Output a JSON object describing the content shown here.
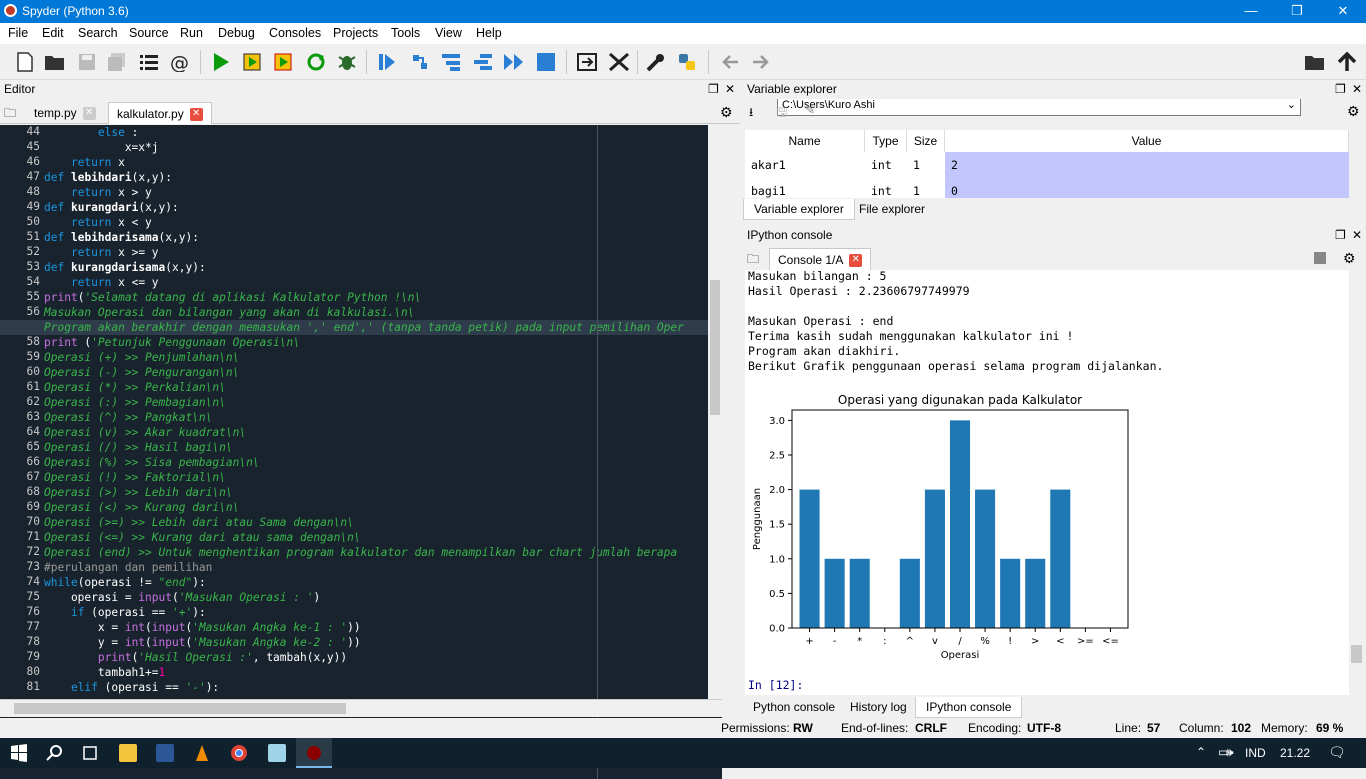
{
  "window": {
    "title": "Spyder (Python 3.6)",
    "minimize": "—",
    "restore": "❐",
    "close": "✕"
  },
  "menu": [
    "File",
    "Edit",
    "Search",
    "Source",
    "Run",
    "Debug",
    "Consoles",
    "Projects",
    "Tools",
    "View",
    "Help"
  ],
  "toolbar": {
    "path": "C:\\Users\\Kuro Ashi",
    "icons": [
      "new-file-icon",
      "open-folder-icon",
      "save-icon",
      "save-all-icon",
      "outline-icon",
      "at-icon",
      "run-icon",
      "run-cell-icon",
      "run-cell-advance-icon",
      "rerun-icon",
      "run-selection-icon",
      "debug-icon",
      "step-icon",
      "step-into-icon",
      "step-return-icon",
      "continue-icon",
      "stop-icon",
      "maximize-pane-icon",
      "fullscreen-icon",
      "preferences-icon",
      "python-path-icon",
      "back-icon",
      "forward-icon",
      "browse-icon",
      "parent-dir-icon"
    ]
  },
  "editor": {
    "pane_title": "Editor",
    "tabs": [
      {
        "label": "temp.py",
        "active": false
      },
      {
        "label": "kalkulator.py",
        "active": true
      }
    ],
    "lines": [
      {
        "n": "44",
        "segs": [
          [
            "        ",
            ""
          ],
          [
            "else",
            ""
          ],
          [
            " :",
            ""
          ]
        ],
        "kwfirst": true
      },
      {
        "n": "45",
        "segs": [
          [
            "            x=x*j",
            ""
          ]
        ]
      },
      {
        "n": "46",
        "segs": [
          [
            "    ",
            ""
          ],
          [
            "return",
            "kw"
          ],
          [
            " x",
            ""
          ]
        ]
      },
      {
        "n": "47",
        "segs": [
          [
            "def",
            "kw"
          ],
          [
            " ",
            ""
          ],
          [
            "lebihdari",
            "fn"
          ],
          [
            "(x,y):",
            ""
          ]
        ]
      },
      {
        "n": "48",
        "segs": [
          [
            "    ",
            ""
          ],
          [
            "return",
            "kw"
          ],
          [
            " x > y",
            ""
          ]
        ]
      },
      {
        "n": "49",
        "segs": [
          [
            "def",
            "kw"
          ],
          [
            " ",
            ""
          ],
          [
            "kurangdari",
            "fn"
          ],
          [
            "(x,y):",
            ""
          ]
        ]
      },
      {
        "n": "50",
        "segs": [
          [
            "    ",
            ""
          ],
          [
            "return",
            "kw"
          ],
          [
            " x < y",
            ""
          ]
        ]
      },
      {
        "n": "51",
        "segs": [
          [
            "def",
            "kw"
          ],
          [
            " ",
            ""
          ],
          [
            "lebihdarisama",
            "fn"
          ],
          [
            "(x,y):",
            ""
          ]
        ]
      },
      {
        "n": "52",
        "segs": [
          [
            "    ",
            ""
          ],
          [
            "return",
            "kw"
          ],
          [
            " x >= y",
            ""
          ]
        ]
      },
      {
        "n": "53",
        "segs": [
          [
            "def",
            "kw"
          ],
          [
            " ",
            ""
          ],
          [
            "kurangdarisama",
            "fn"
          ],
          [
            "(x,y):",
            ""
          ]
        ]
      },
      {
        "n": "54",
        "segs": [
          [
            "    ",
            ""
          ],
          [
            "return",
            "kw"
          ],
          [
            " x <= y",
            ""
          ]
        ]
      },
      {
        "n": "55",
        "segs": [
          [
            "print",
            "bi"
          ],
          [
            "(",
            ""
          ],
          [
            "'Selamat datang di aplikasi Kalkulator Python !\\n\\",
            "st"
          ]
        ]
      },
      {
        "n": "56",
        "segs": [
          [
            "Masukan Operasi dan bilangan yang akan di kalkulasi.\\n\\",
            "st"
          ]
        ]
      },
      {
        "n": "57",
        "segs": [
          [
            "Program akan berakhir dengan memasukan ',' end',' (tanpa tanda petik) pada input pemilihan Oper",
            "st"
          ]
        ],
        "current": true
      },
      {
        "n": "58",
        "segs": [
          [
            "print",
            "bi"
          ],
          [
            " (",
            ""
          ],
          [
            "'Petunjuk Penggunaan Operasi\\n\\",
            "st"
          ]
        ]
      },
      {
        "n": "59",
        "segs": [
          [
            "Operasi (+) >> Penjumlahan\\n\\",
            "st"
          ]
        ]
      },
      {
        "n": "60",
        "segs": [
          [
            "Operasi (-) >> Pengurangan\\n\\",
            "st"
          ]
        ]
      },
      {
        "n": "61",
        "segs": [
          [
            "Operasi (*) >> Perkalian\\n\\",
            "st"
          ]
        ]
      },
      {
        "n": "62",
        "segs": [
          [
            "Operasi (:) >> Pembagian\\n\\",
            "st"
          ]
        ]
      },
      {
        "n": "63",
        "segs": [
          [
            "Operasi (^) >> Pangkat\\n\\",
            "st"
          ]
        ]
      },
      {
        "n": "64",
        "segs": [
          [
            "Operasi (v) >> Akar kuadrat\\n\\",
            "st"
          ]
        ]
      },
      {
        "n": "65",
        "segs": [
          [
            "Operasi (/) >> Hasil bagi\\n\\",
            "st"
          ]
        ]
      },
      {
        "n": "66",
        "segs": [
          [
            "Operasi (%) >> Sisa pembagian\\n\\",
            "st"
          ]
        ]
      },
      {
        "n": "67",
        "segs": [
          [
            "Operasi (!) >> Faktorial\\n\\",
            "st"
          ]
        ]
      },
      {
        "n": "68",
        "segs": [
          [
            "Operasi (>) >> Lebih dari\\n\\",
            "st"
          ]
        ]
      },
      {
        "n": "69",
        "segs": [
          [
            "Operasi (<) >> Kurang dari\\n\\",
            "st"
          ]
        ]
      },
      {
        "n": "70",
        "segs": [
          [
            "Operasi (>=) >> Lebih dari atau Sama dengan\\n\\",
            "st"
          ]
        ]
      },
      {
        "n": "71",
        "segs": [
          [
            "Operasi (<=) >> Kurang dari atau sama dengan\\n\\",
            "st"
          ]
        ]
      },
      {
        "n": "72",
        "segs": [
          [
            "Operasi (end) >> Untuk menghentikan program kalkulator dan menampilkan bar chart jumlah berapa",
            "st"
          ]
        ]
      },
      {
        "n": "73",
        "segs": [
          [
            "#perulangan dan pemilihan",
            "cm"
          ]
        ]
      },
      {
        "n": "74",
        "segs": [
          [
            "while",
            "kw"
          ],
          [
            "(operasi != ",
            ""
          ],
          [
            "\"end\"",
            "st"
          ],
          [
            "):",
            ""
          ]
        ]
      },
      {
        "n": "75",
        "segs": [
          [
            "    operasi = ",
            ""
          ],
          [
            "input",
            "bi"
          ],
          [
            "(",
            ""
          ],
          [
            "'Masukan Operasi : '",
            "st"
          ],
          [
            ")",
            ""
          ]
        ]
      },
      {
        "n": "76",
        "segs": [
          [
            "    ",
            ""
          ],
          [
            "if",
            "kw"
          ],
          [
            " (operasi == ",
            ""
          ],
          [
            "'+'",
            "st"
          ],
          [
            "):",
            ""
          ]
        ]
      },
      {
        "n": "77",
        "segs": [
          [
            "        x = ",
            ""
          ],
          [
            "int",
            "bi"
          ],
          [
            "(",
            ""
          ],
          [
            "input",
            "bi"
          ],
          [
            "(",
            ""
          ],
          [
            "'Masukan Angka ke-1 : '",
            "st"
          ],
          [
            "))",
            ""
          ]
        ]
      },
      {
        "n": "78",
        "segs": [
          [
            "        y = ",
            ""
          ],
          [
            "int",
            "bi"
          ],
          [
            "(",
            ""
          ],
          [
            "input",
            "bi"
          ],
          [
            "(",
            ""
          ],
          [
            "'Masukan Angka ke-2 : '",
            "st"
          ],
          [
            "))",
            ""
          ]
        ]
      },
      {
        "n": "79",
        "segs": [
          [
            "        ",
            ""
          ],
          [
            "print",
            "bi"
          ],
          [
            "(",
            ""
          ],
          [
            "'Hasil Operasi :'",
            "st"
          ],
          [
            ", tambah(x,y))",
            ""
          ]
        ]
      },
      {
        "n": "80",
        "segs": [
          [
            "        tambah1+=",
            ""
          ],
          [
            "1",
            "nu"
          ]
        ]
      },
      {
        "n": "81",
        "segs": [
          [
            "    ",
            ""
          ],
          [
            "elif",
            "kw"
          ],
          [
            " (operasi == ",
            ""
          ],
          [
            "'-'",
            "st"
          ],
          [
            "):",
            ""
          ]
        ]
      }
    ]
  },
  "variable_explorer": {
    "pane_title": "Variable explorer",
    "columns": [
      "Name",
      "Type",
      "Size",
      "Value"
    ],
    "rows": [
      {
        "name": "akar1",
        "type": "int",
        "size": "1",
        "value": "2"
      },
      {
        "name": "bagi1",
        "type": "int",
        "size": "1",
        "value": "0"
      }
    ],
    "tabs": [
      "Variable explorer",
      "File explorer"
    ]
  },
  "ipython": {
    "pane_title": "IPython console",
    "tab": "Console 1/A",
    "lines": [
      "Masukan bilangan : 5",
      "Hasil Operasi : 2.23606797749979",
      "",
      "Masukan Operasi : end",
      "Terima kasih sudah menggunakan kalkulator ini !",
      "Program akan diakhiri.",
      "Berikut Grafik penggunaan operasi selama program dijalankan."
    ],
    "prompt": "In [12]:",
    "tabs": [
      "Python console",
      "History log",
      "IPython console"
    ]
  },
  "chart_data": {
    "type": "bar",
    "title": "Operasi yang digunakan pada Kalkulator",
    "xlabel": "Operasi",
    "ylabel": "Penggunaan",
    "categories": [
      "+",
      "-",
      "*",
      ":",
      "^",
      "v",
      "/",
      "%",
      "!",
      ">",
      "<",
      ">=",
      "<="
    ],
    "values": [
      2,
      1,
      1,
      0,
      1,
      2,
      3,
      2,
      1,
      1,
      2,
      0,
      0
    ],
    "yticks": [
      "0.0",
      "0.5",
      "1.0",
      "1.5",
      "2.0",
      "2.5",
      "3.0"
    ],
    "ylim": [
      0,
      3.15
    ],
    "bar_color": "#1f77b4"
  },
  "status": {
    "permissions_label": "Permissions:",
    "permissions": "RW",
    "eol_label": "End-of-lines:",
    "eol": "CRLF",
    "encoding_label": "Encoding:",
    "encoding": "UTF-8",
    "line_label": "Line:",
    "line": "57",
    "column_label": "Column:",
    "column": "102",
    "memory_label": "Memory:",
    "memory": "69 %"
  },
  "taskbar": {
    "lang": "IND",
    "time": "21.22"
  }
}
